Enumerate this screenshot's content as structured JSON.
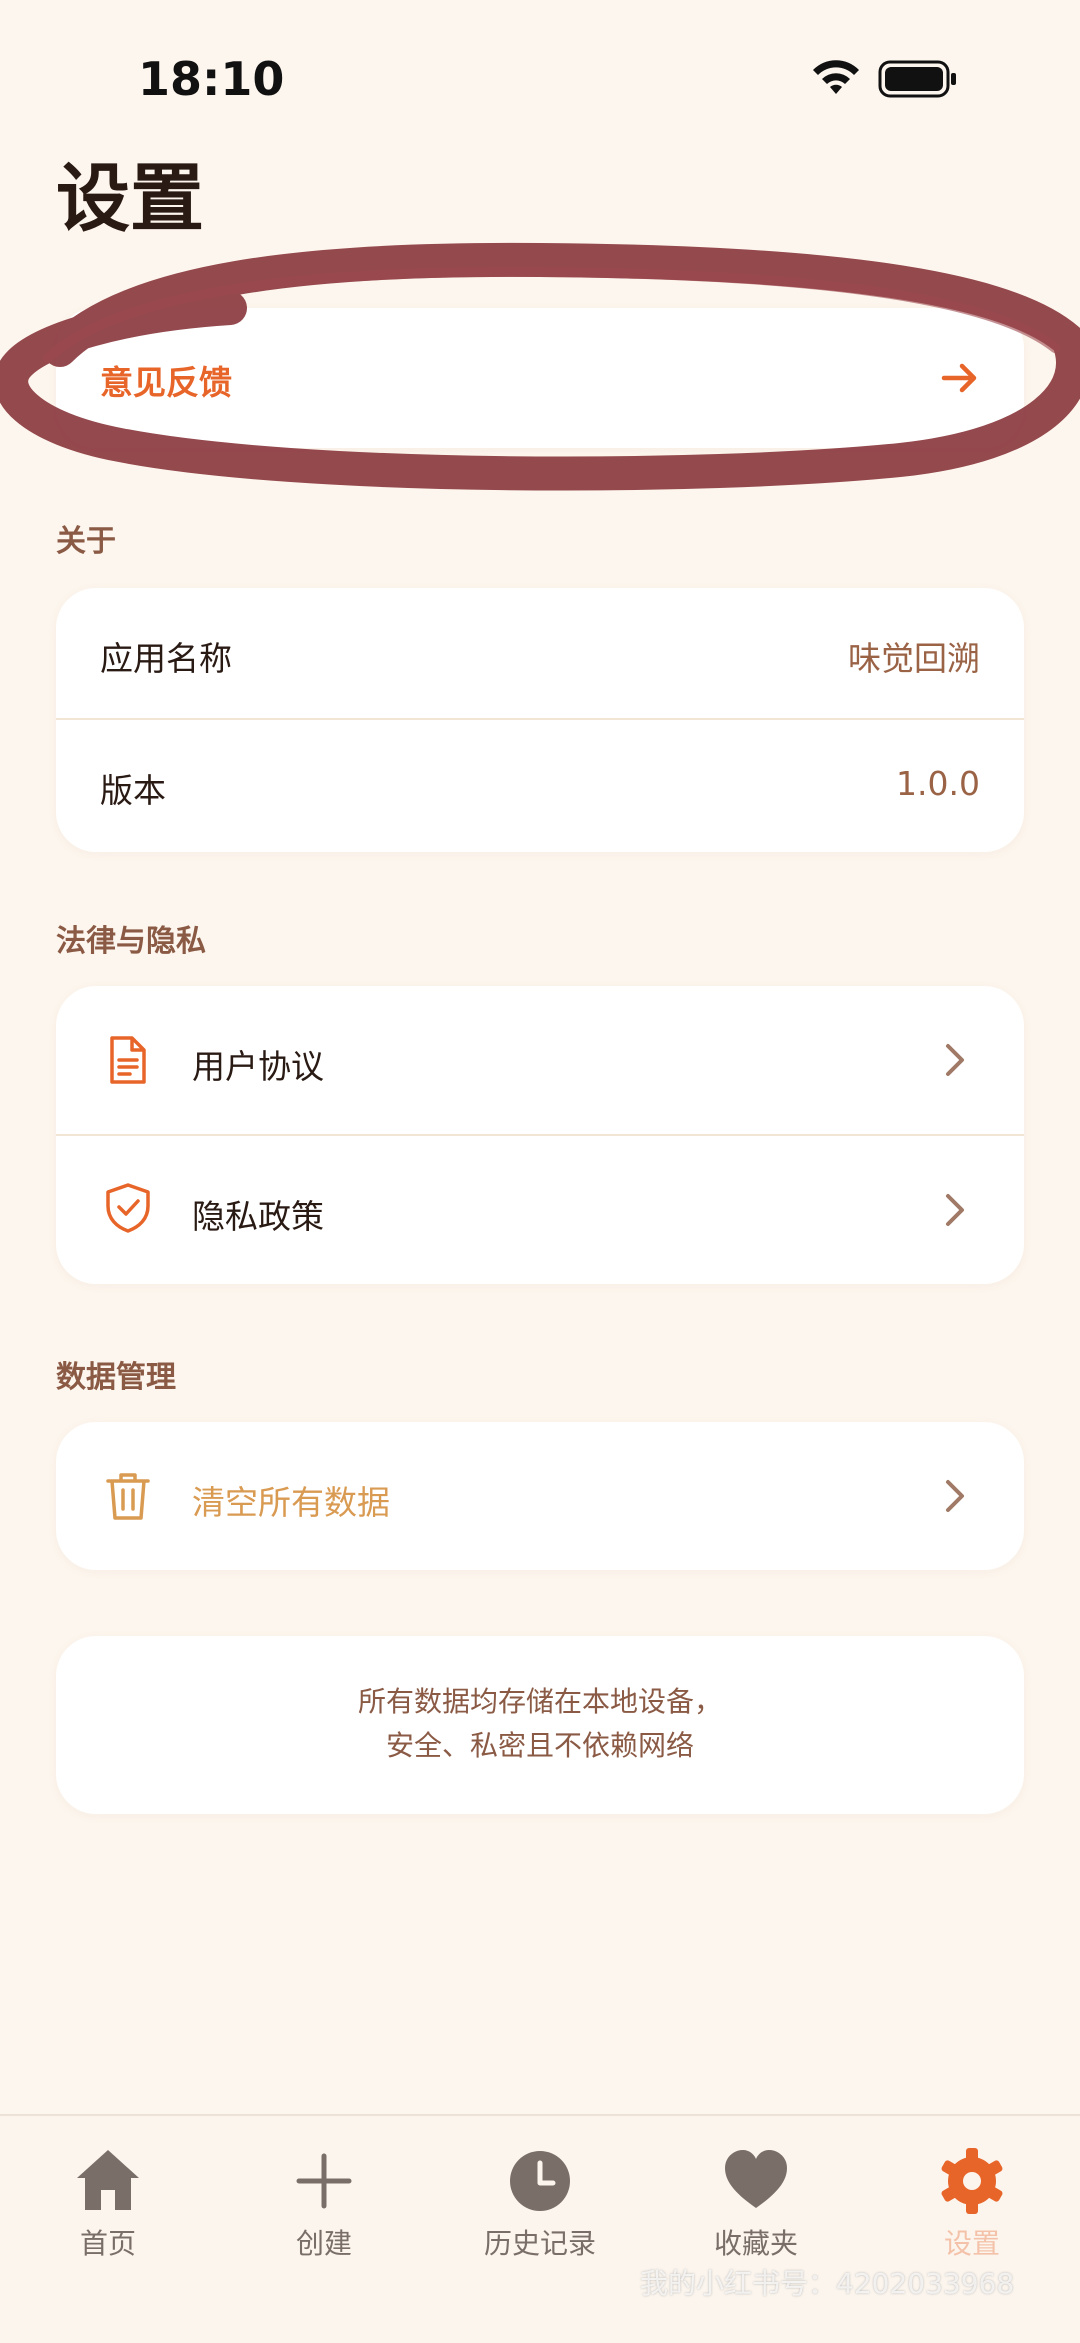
{
  "status_bar": {
    "time": "18:10"
  },
  "page": {
    "title": "设置"
  },
  "feedback": {
    "label": "意见反馈"
  },
  "about": {
    "header": "关于",
    "app_name_label": "应用名称",
    "app_name_value": "味觉回溯",
    "version_label": "版本",
    "version_value": "1.0.0"
  },
  "legal": {
    "header": "法律与隐私",
    "user_agreement": "用户协议",
    "privacy_policy": "隐私政策"
  },
  "data_management": {
    "header": "数据管理",
    "clear_all": "清空所有数据"
  },
  "note": {
    "line1": "所有数据均存储在本地设备，",
    "line2": "安全、私密且不依赖网络"
  },
  "tab_bar": {
    "items": [
      {
        "label": "首页",
        "icon": "home-icon"
      },
      {
        "label": "创建",
        "icon": "plus-icon"
      },
      {
        "label": "历史记录",
        "icon": "clock-icon"
      },
      {
        "label": "收藏夹",
        "icon": "heart-icon"
      },
      {
        "label": "设置",
        "icon": "gear-icon",
        "active": true
      }
    ]
  },
  "watermark": "我的小红书号：4202033968",
  "colors": {
    "background": "#fdf6ee",
    "accent": "#e8652a",
    "muted_brown": "#8a5a45",
    "scribble": "#8b3a3f"
  }
}
